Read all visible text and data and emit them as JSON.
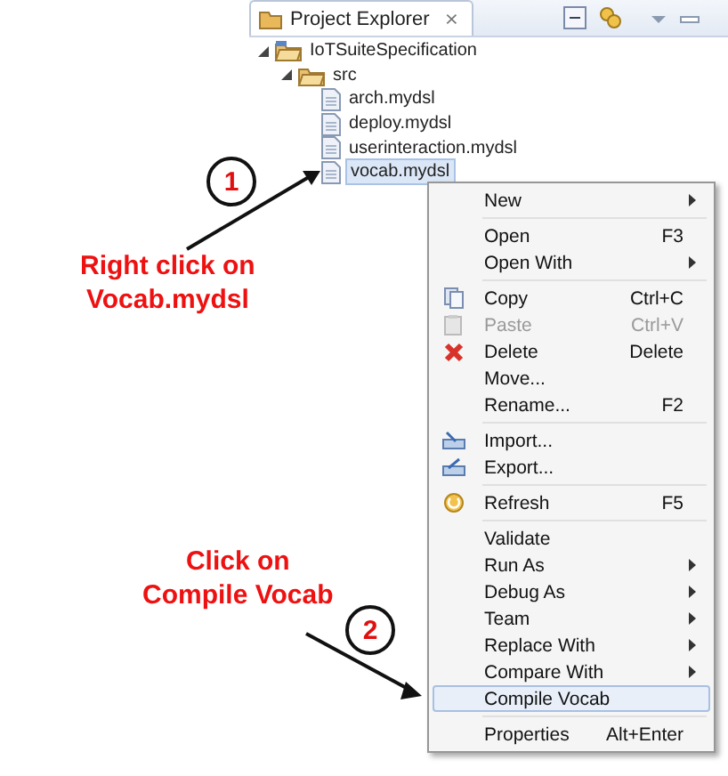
{
  "view": {
    "title": "Project Explorer",
    "close": "⨯"
  },
  "tree": [
    {
      "label": "IoTSuiteSpecification",
      "expanded": true,
      "selected": false,
      "children": [
        {
          "label": "src",
          "expanded": true,
          "selected": false,
          "children": [
            {
              "label": "arch.mydsl",
              "selected": false
            },
            {
              "label": "deploy.mydsl",
              "selected": false
            },
            {
              "label": "userinteraction.mydsl",
              "selected": false
            },
            {
              "label": "vocab.mydsl",
              "selected": true
            }
          ]
        }
      ]
    }
  ],
  "context_menu": [
    {
      "kind": "item",
      "label": "New",
      "submenu": true,
      "disabled": false,
      "selected": false
    },
    {
      "kind": "separator"
    },
    {
      "kind": "item",
      "label": "Open",
      "shortcut": "F3",
      "disabled": false,
      "selected": false
    },
    {
      "kind": "item",
      "label": "Open With",
      "submenu": true,
      "disabled": false,
      "selected": false
    },
    {
      "kind": "separator"
    },
    {
      "kind": "item",
      "label": "Copy",
      "shortcut": "Ctrl+C",
      "disabled": false,
      "selected": false
    },
    {
      "kind": "item",
      "label": "Paste",
      "shortcut": "Ctrl+V",
      "disabled": true,
      "selected": false
    },
    {
      "kind": "item",
      "label": "Delete",
      "shortcut": "Delete",
      "disabled": false,
      "selected": false
    },
    {
      "kind": "item",
      "label": "Move...",
      "disabled": false,
      "selected": false
    },
    {
      "kind": "item",
      "label": "Rename...",
      "shortcut": "F2",
      "disabled": false,
      "selected": false
    },
    {
      "kind": "separator"
    },
    {
      "kind": "item",
      "label": "Import...",
      "disabled": false,
      "selected": false
    },
    {
      "kind": "item",
      "label": "Export...",
      "disabled": false,
      "selected": false
    },
    {
      "kind": "separator"
    },
    {
      "kind": "item",
      "label": "Refresh",
      "shortcut": "F5",
      "disabled": false,
      "selected": false
    },
    {
      "kind": "separator"
    },
    {
      "kind": "item",
      "label": "Validate",
      "disabled": false,
      "selected": false
    },
    {
      "kind": "item",
      "label": "Run As",
      "submenu": true,
      "disabled": false,
      "selected": false
    },
    {
      "kind": "item",
      "label": "Debug As",
      "submenu": true,
      "disabled": false,
      "selected": false
    },
    {
      "kind": "item",
      "label": "Team",
      "submenu": true,
      "disabled": false,
      "selected": false
    },
    {
      "kind": "item",
      "label": "Replace With",
      "submenu": true,
      "disabled": false,
      "selected": false
    },
    {
      "kind": "item",
      "label": "Compare With",
      "submenu": true,
      "disabled": false,
      "selected": false
    },
    {
      "kind": "item",
      "label": "Compile Vocab",
      "disabled": false,
      "selected": true
    },
    {
      "kind": "separator"
    },
    {
      "kind": "item",
      "label": "Properties",
      "shortcut": "Alt+Enter",
      "disabled": false,
      "selected": false
    }
  ],
  "annotations": [
    {
      "step": "1",
      "text": "Right click on\nVocab.mydsl"
    },
    {
      "step": "2",
      "text": "Click on\nCompile Vocab"
    }
  ]
}
